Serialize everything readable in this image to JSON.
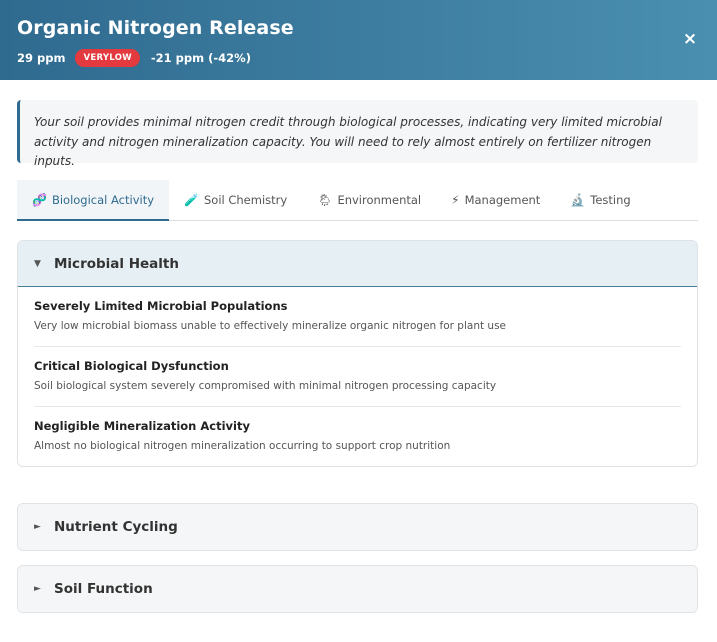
{
  "header": {
    "title": "Organic Nitrogen Release",
    "ppm": "29 ppm",
    "badge": "VERYLOW",
    "change": "-21 ppm (-42%)",
    "close": "×"
  },
  "summary": "Your soil provides minimal nitrogen credit through biological processes, indicating very limited microbial activity and nitrogen mineralization capacity. You will need to rely almost entirely on fertilizer nitrogen inputs.",
  "tabs": [
    {
      "icon": "🧬",
      "label": "Biological Activity",
      "active": true
    },
    {
      "icon": "🧪",
      "label": "Soil Chemistry",
      "active": false
    },
    {
      "icon": "🌦",
      "label": "Environmental",
      "active": false
    },
    {
      "icon": "⚡",
      "label": "Management",
      "active": false
    },
    {
      "icon": "🔬",
      "label": "Testing",
      "active": false
    }
  ],
  "sections": [
    {
      "title": "Microbial Health",
      "arrow": "▼",
      "items": [
        {
          "title": "Severely Limited Microbial Populations",
          "desc": "Very low microbial biomass unable to effectively mineralize organic nitrogen for plant use"
        },
        {
          "title": "Critical Biological Dysfunction",
          "desc": "Soil biological system severely compromised with minimal nitrogen processing capacity"
        },
        {
          "title": "Negligible Mineralization Activity",
          "desc": "Almost no biological nitrogen mineralization occurring to support crop nutrition"
        }
      ]
    },
    {
      "title": "Nutrient Cycling",
      "arrow": "►"
    },
    {
      "title": "Soil Function",
      "arrow": "►"
    }
  ]
}
